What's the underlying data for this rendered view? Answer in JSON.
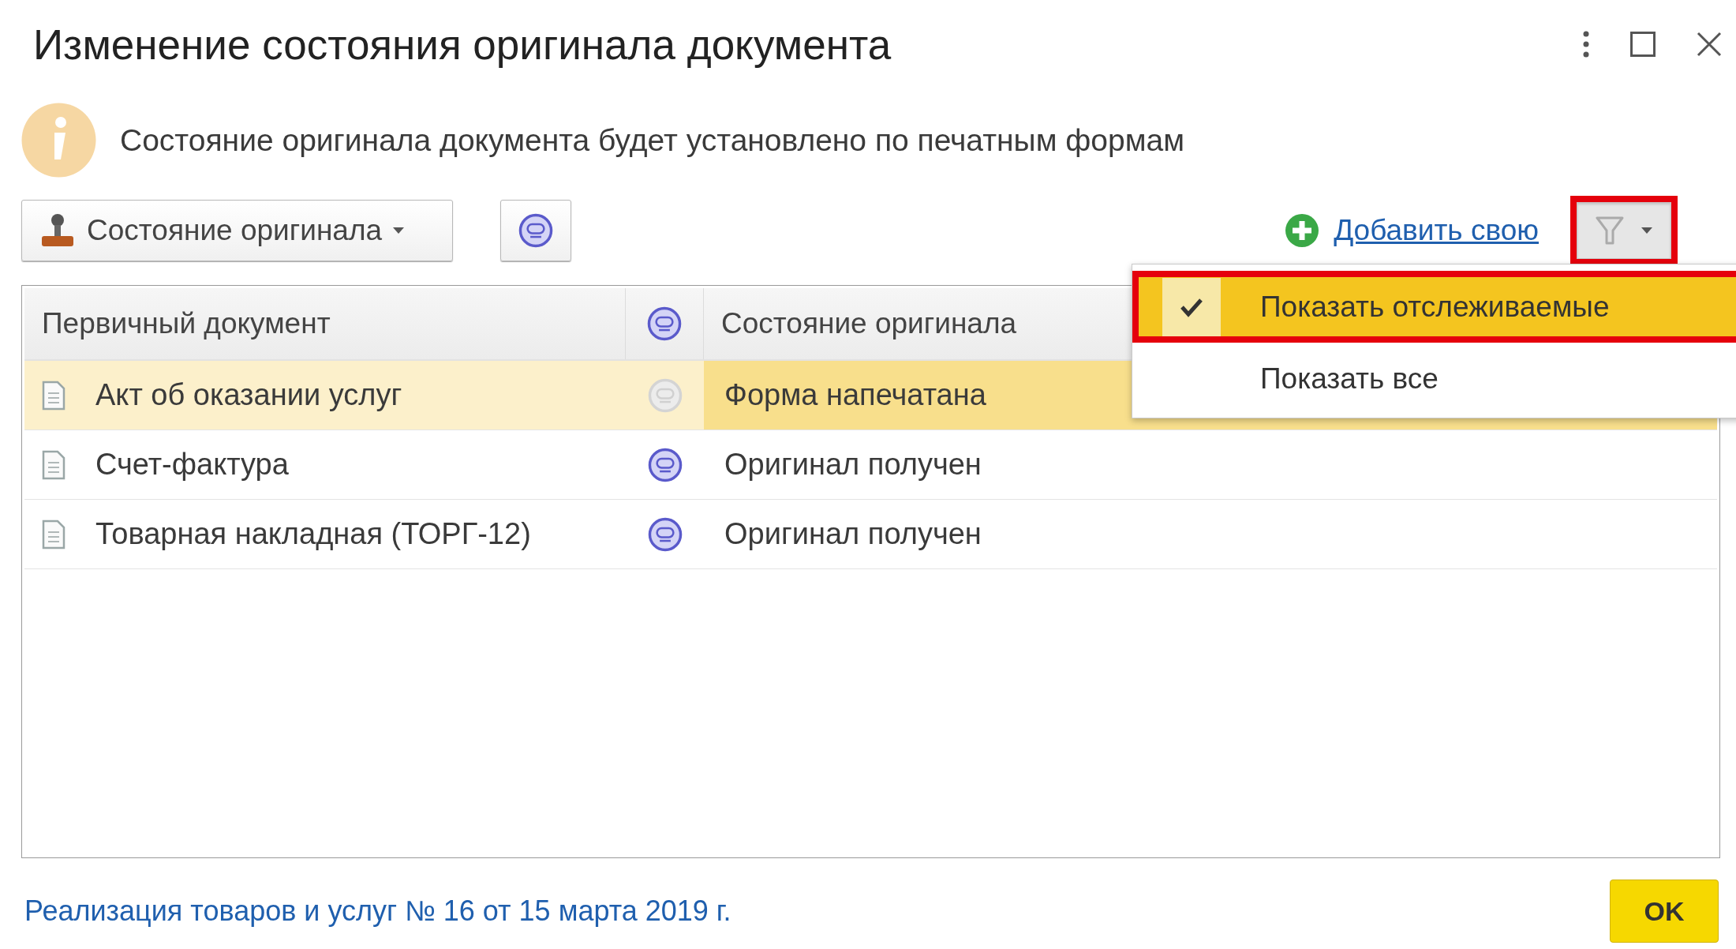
{
  "window": {
    "title": "Изменение состояния оригинала документа"
  },
  "info": {
    "message": "Состояние оригинала документа будет установлено по печатным формам"
  },
  "toolbar": {
    "state_button": {
      "label": "Состояние оригинала"
    },
    "add_link": {
      "label": "Добавить свою"
    },
    "filter_button": {
      "highlight_frame": true,
      "open": true
    }
  },
  "filter_menu": {
    "items": [
      {
        "label": "Показать отслеживаемые",
        "checked": true,
        "selected": true,
        "highlight_frame": true
      },
      {
        "label": "Показать все",
        "checked": false,
        "selected": false,
        "highlight_frame": false
      }
    ]
  },
  "table": {
    "columns": [
      {
        "kind": "text",
        "label": "Первичный документ"
      },
      {
        "kind": "icon"
      },
      {
        "kind": "text",
        "label": "Состояние оригинала"
      }
    ],
    "rows": [
      {
        "document": "Акт об оказании услуг",
        "state_icon_dimmed": true,
        "state": "Форма напечатана",
        "selected": true
      },
      {
        "document": "Счет-фактура",
        "state_icon_dimmed": false,
        "state": "Оригинал получен",
        "selected": false
      },
      {
        "document": "Товарная накладная (ТОРГ-12)",
        "state_icon_dimmed": false,
        "state": "Оригинал получен",
        "selected": false
      }
    ]
  },
  "footer": {
    "document_link": "Реализация товаров и услуг № 16 от 15 марта 2019 г.",
    "ok_button": "OK"
  }
}
